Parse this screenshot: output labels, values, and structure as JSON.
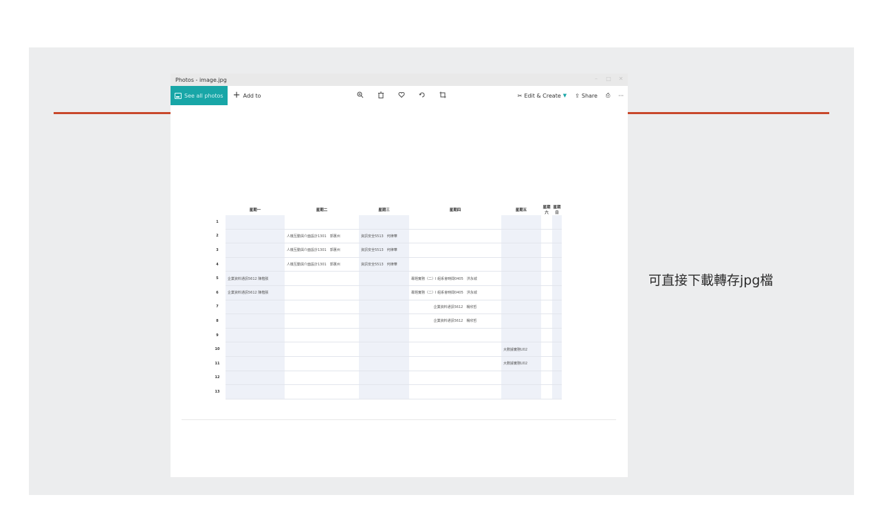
{
  "slide": {
    "caption": "可直接下載轉存jpg檔",
    "accent_color": "#c8472a"
  },
  "window": {
    "title": "Photos - image.jpg",
    "accent_color": "#18a6a7"
  },
  "toolbar": {
    "see_all_label": "See all photos",
    "see_all_icon": "photo-icon",
    "add_to_label": "Add to",
    "add_icon": "plus-icon",
    "center_icons": [
      "zoom-in-icon",
      "delete-icon",
      "heart-icon",
      "rotate-icon",
      "crop-icon"
    ],
    "edit_create_label": "Edit & Create",
    "share_label": "Share",
    "print_icon": "print-icon",
    "more_icon": "more-icon"
  },
  "schedule": {
    "headers": [
      "星期一",
      "星期二",
      "星期三",
      "星期四",
      "星期五",
      "星期六",
      "星期日"
    ],
    "rows": [
      {
        "num": "1",
        "cells": [
          "",
          "",
          "",
          "",
          "",
          "",
          ""
        ]
      },
      {
        "num": "2",
        "cells": [
          "",
          "人機互動與介面設計1301　郭蕙州",
          "資訊安全5513　何律華",
          "",
          "",
          "",
          ""
        ]
      },
      {
        "num": "3",
        "cells": [
          "",
          "人機互動與介面設計1301　郭蕙州",
          "資訊安全5513　何律華",
          "",
          "",
          "",
          ""
        ]
      },
      {
        "num": "4",
        "cells": [
          "",
          "人機互動與介面設計1301　郭蕙州",
          "資訊安全5513　何律華",
          "",
          "",
          "",
          ""
        ]
      },
      {
        "num": "5",
        "cells": [
          "企業資料通訊5612 陳楷朕",
          "",
          "",
          "專題實務（二）I 組系會時間0405　洪永城",
          "",
          "",
          ""
        ]
      },
      {
        "num": "6",
        "cells": [
          "企業資料通訊5612 陳楷朕",
          "",
          "",
          "專題實務（二）I 組系會時間0405　洪永城",
          "",
          "",
          ""
        ]
      },
      {
        "num": "7",
        "cells": [
          "",
          "",
          "",
          "企業資料通訊5612　楊欣哲",
          "",
          "",
          ""
        ]
      },
      {
        "num": "8",
        "cells": [
          "",
          "",
          "",
          "企業資料通訊5612　楊欣哲",
          "",
          "",
          ""
        ]
      },
      {
        "num": "9",
        "cells": [
          "",
          "",
          "",
          "",
          "",
          "",
          ""
        ]
      },
      {
        "num": "10",
        "cells": [
          "",
          "",
          "",
          "",
          "大數據實務U02",
          "",
          ""
        ]
      },
      {
        "num": "11",
        "cells": [
          "",
          "",
          "",
          "",
          "大數據實務U02",
          "",
          ""
        ]
      },
      {
        "num": "12",
        "cells": [
          "",
          "",
          "",
          "",
          "",
          "",
          ""
        ]
      },
      {
        "num": "13",
        "cells": [
          "",
          "",
          "",
          "",
          "",
          "",
          ""
        ]
      }
    ]
  }
}
